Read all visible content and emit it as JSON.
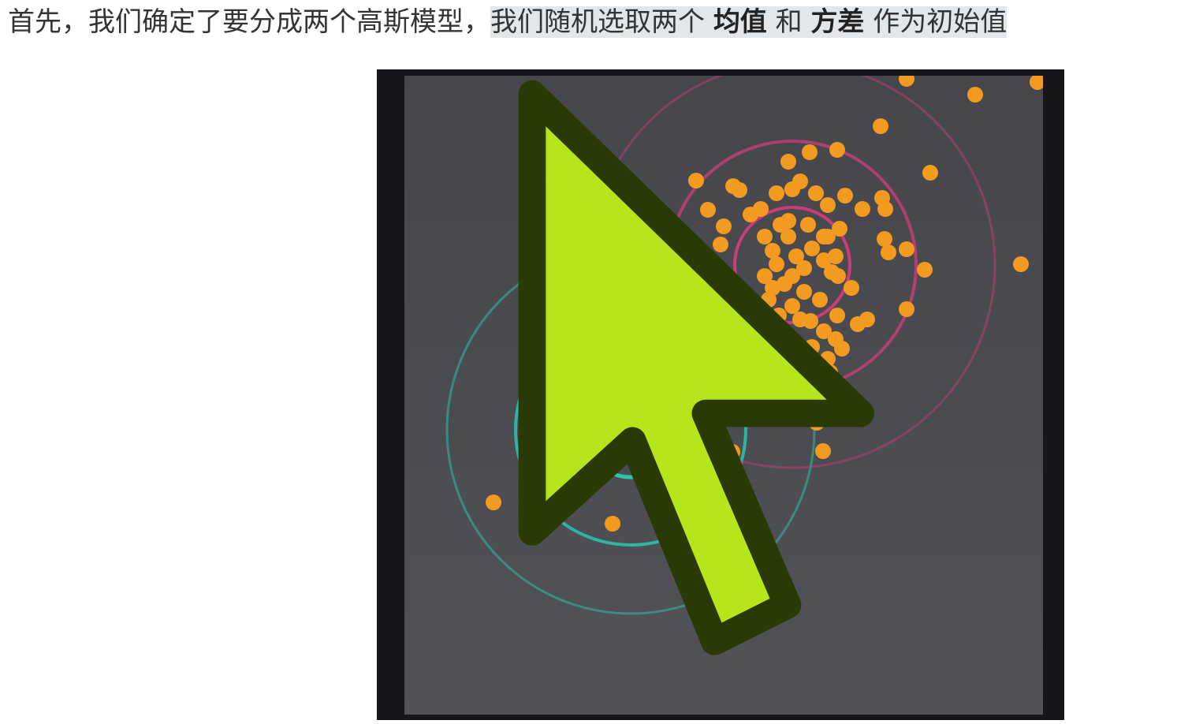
{
  "caption": {
    "prefix": "首先，我们确定了要分成两个高斯模型，",
    "hl_part1": "我们随机选取两个 ",
    "bold_mean": "均值",
    "hl_part2": " 和 ",
    "bold_variance": "方差",
    "hl_part3": " 作为初始值"
  },
  "figure": {
    "background_color": "#4a4c51",
    "point_color": "#f39a21",
    "cursor_color": "#b7e51c",
    "gaussians": [
      {
        "name": "teal-gaussian",
        "color": "#2ac7b0"
      },
      {
        "name": "pink-gaussian",
        "color": "#d13c7b"
      }
    ]
  }
}
